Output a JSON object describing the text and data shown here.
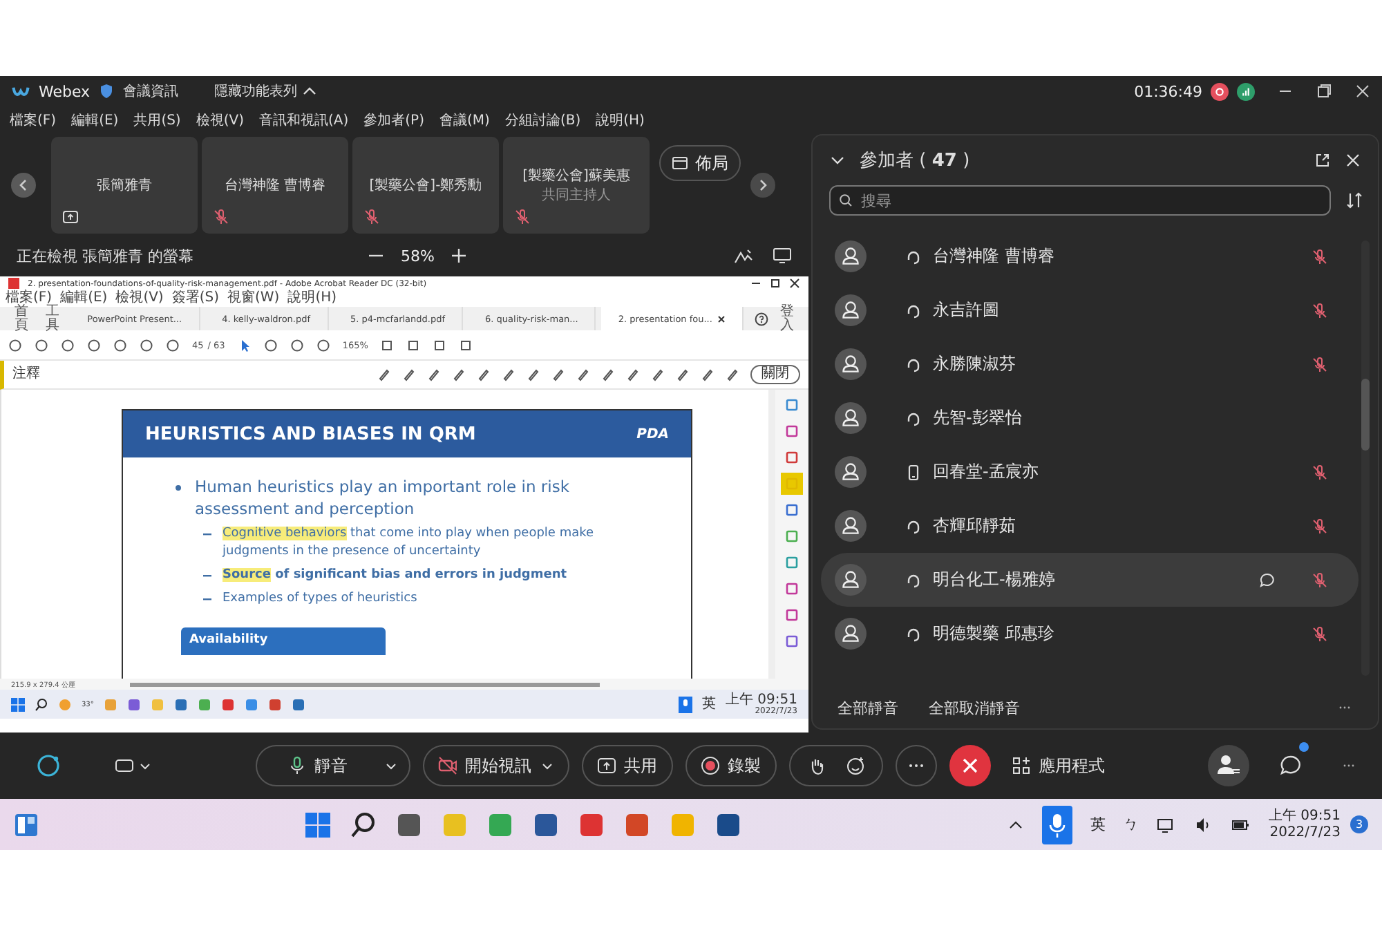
{
  "window": {
    "app_name": "Webex",
    "meeting_info": "會議資訊",
    "hide_menu": "隱藏功能表列",
    "timer": "01:36:49"
  },
  "menu": [
    "檔案(F)",
    "編輯(E)",
    "共用(S)",
    "檢視(V)",
    "音訊和視訊(A)",
    "參加者(P)",
    "會議(M)",
    "分組討論(B)",
    "說明(H)"
  ],
  "video_strip": {
    "layout_button": "佈局",
    "tiles": [
      {
        "name": "張簡雅青",
        "kind": "sharing"
      },
      {
        "name": "台灣神隆 曹博睿",
        "kind": "muted"
      },
      {
        "name": "[製藥公會]-鄭秀勳",
        "kind": "muted"
      },
      {
        "name": "[製藥公會]蘇美惠",
        "subtitle": "共同主持人",
        "kind": "muted"
      }
    ]
  },
  "viewing": {
    "label": "正在檢視 張簡雅青 的螢幕",
    "zoom": "58%"
  },
  "shared_screen": {
    "title": "2. presentation-foundations-of-quality-risk-management.pdf - Adobe Acrobat Reader DC (32-bit)",
    "menu": [
      "檔案(F)",
      "編輯(E)",
      "檢視(V)",
      "簽署(S)",
      "視窗(W)",
      "說明(H)"
    ],
    "nav": [
      "首頁",
      "工具"
    ],
    "tabs": [
      {
        "label": "PowerPoint Present...",
        "selected": false
      },
      {
        "label": "4. kelly-waldron.pdf",
        "selected": false
      },
      {
        "label": "5. p4-mcfarlandd.pdf",
        "selected": false
      },
      {
        "label": "6. quality-risk-man...",
        "selected": false
      },
      {
        "label": "2. presentation fou...",
        "selected": true
      }
    ],
    "sign_in": "登入",
    "page": "45",
    "page_total": "/ 63",
    "zoom": "165%",
    "comment_label": "注釋",
    "close": "關閉",
    "slide": {
      "title": "HEURISTICS AND BIASES IN QRM",
      "logo": "PDA",
      "bullet": "Human heuristics play an important role in risk assessment and perception",
      "sub_bullets": [
        {
          "highlight": "Cognitive behaviors",
          "text": " that come into play when people make judgments in the presence of uncertainty",
          "bold": false
        },
        {
          "highlight": "Source",
          "text": " of significant bias and errors in judgment",
          "bold": true
        },
        {
          "text": "Examples of types of heuristics",
          "bold": false
        }
      ],
      "box": "Availability"
    },
    "page_size": "215.9 x 279.4 公厘",
    "taskbar": {
      "weather": "33°",
      "lang": "英",
      "time": "上午 09:51",
      "date": "2022/7/23"
    }
  },
  "participants": {
    "title": "參加者 ( **47** )",
    "search_placeholder": "搜尋",
    "items": [
      {
        "name": "台灣神隆 曹博睿",
        "kind": "headset",
        "muted": true,
        "selected": false,
        "chat": false
      },
      {
        "name": "永吉許圖",
        "kind": "headset",
        "muted": true,
        "selected": false,
        "chat": false
      },
      {
        "name": "永勝陳淑芬",
        "kind": "headset",
        "muted": true,
        "selected": false,
        "chat": false
      },
      {
        "name": "先智-彭翠怡",
        "kind": "headset",
        "muted": false,
        "selected": false,
        "chat": false
      },
      {
        "name": "回春堂-孟宸亦",
        "kind": "phone",
        "muted": true,
        "selected": false,
        "chat": false
      },
      {
        "name": "杏輝邱靜茹",
        "kind": "headset",
        "muted": true,
        "selected": false,
        "chat": false
      },
      {
        "name": "明台化工-楊雅婷",
        "kind": "headset",
        "muted": true,
        "selected": true,
        "chat": true
      },
      {
        "name": "明德製藥 邱惠珍",
        "kind": "headset",
        "muted": true,
        "selected": false,
        "chat": false
      }
    ],
    "mute_all": "全部靜音",
    "unmute_all": "全部取消靜音"
  },
  "controls": {
    "mute": "靜音",
    "video": "開始視訊",
    "share": "共用",
    "record": "錄製",
    "apps": "應用程式"
  },
  "taskbar": {
    "lang": "英",
    "ime": "ㄅ",
    "time": "上午 09:51",
    "date": "2022/7/23",
    "badge": "3"
  }
}
